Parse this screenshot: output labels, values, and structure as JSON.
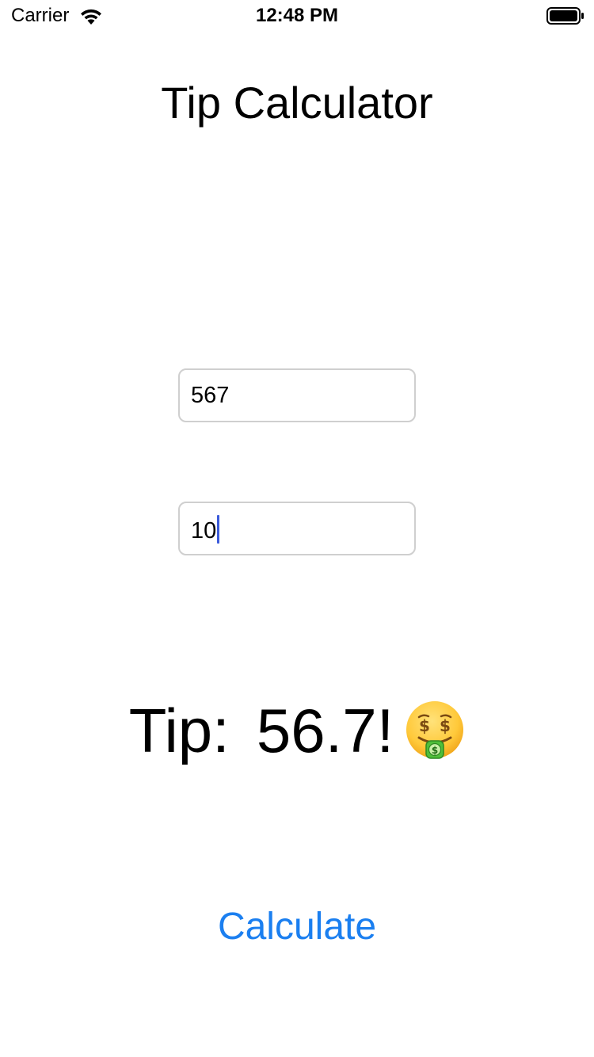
{
  "status_bar": {
    "carrier": "Carrier",
    "time": "12:48 PM",
    "icons": [
      "wifi-icon",
      "battery-icon"
    ]
  },
  "title": "Tip Calculator",
  "fields": {
    "bill_amount": "567",
    "tip_percent": "10"
  },
  "result": {
    "label": "Tip:",
    "value": "56.7!",
    "emoji_icon": "money-mouth-face-icon"
  },
  "calculate_button": "Calculate",
  "colors": {
    "accent": "#1b7ff0",
    "cursor": "#3b5bdb",
    "field_border": "#cfcfcf"
  }
}
